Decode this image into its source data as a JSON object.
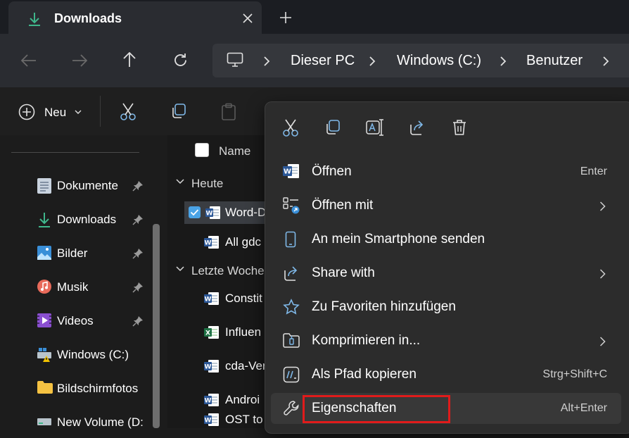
{
  "tab": {
    "title": "Downloads",
    "close_icon": "close-icon",
    "new_tab_icon": "plus-icon"
  },
  "nav": {
    "back_icon": "arrow-left-icon",
    "forward_icon": "arrow-right-icon",
    "up_icon": "arrow-up-icon",
    "refresh_icon": "refresh-icon",
    "breadcrumb": [
      "Dieser PC",
      "Windows (C:)",
      "Benutzer"
    ]
  },
  "command_bar": {
    "new_label": "Neu",
    "icons": [
      "cut-icon",
      "copy-icon",
      "paste-icon"
    ]
  },
  "sidebar": {
    "items": [
      {
        "label": "Dokumente",
        "icon": "documents-icon",
        "pinned": true
      },
      {
        "label": "Downloads",
        "icon": "download-icon",
        "pinned": true
      },
      {
        "label": "Bilder",
        "icon": "pictures-icon",
        "pinned": true
      },
      {
        "label": "Musik",
        "icon": "music-icon",
        "pinned": true
      },
      {
        "label": "Videos",
        "icon": "videos-icon",
        "pinned": true
      },
      {
        "label": "Windows (C:)",
        "icon": "drive-c-icon",
        "pinned": false
      },
      {
        "label": "Bildschirmfotos",
        "icon": "folder-icon",
        "pinned": false
      },
      {
        "label": "New Volume (D:",
        "icon": "drive-icon",
        "pinned": false
      }
    ]
  },
  "file_list": {
    "column_name": "Name",
    "groups": [
      {
        "label": "Heute",
        "files": [
          {
            "name": "Word-D",
            "type": "word",
            "selected": true
          },
          {
            "name": "All gdc",
            "type": "word",
            "selected": false
          }
        ]
      },
      {
        "label": "Letzte Woche",
        "files": [
          {
            "name": "Constit",
            "type": "word"
          },
          {
            "name": "Influen",
            "type": "excel"
          },
          {
            "name": "cda-Ver",
            "type": "word"
          },
          {
            "name": "Androi",
            "type": "word"
          },
          {
            "name": "OST to",
            "type": "word"
          }
        ]
      }
    ]
  },
  "context_menu": {
    "top_actions": [
      "cut-icon",
      "copy-icon",
      "rename-icon",
      "share-icon",
      "delete-icon"
    ],
    "items": [
      {
        "label": "Öffnen",
        "shortcut": "Enter",
        "icon": "word-icon",
        "submenu": false
      },
      {
        "label": "Öffnen mit",
        "shortcut": "",
        "icon": "open-with-icon",
        "submenu": true
      },
      {
        "label": "An mein Smartphone senden",
        "shortcut": "",
        "icon": "phone-icon",
        "submenu": false
      },
      {
        "label": "Share with",
        "shortcut": "",
        "icon": "share-icon",
        "submenu": true
      },
      {
        "label": "Zu Favoriten hinzufügen",
        "shortcut": "",
        "icon": "star-icon",
        "submenu": false
      },
      {
        "label": "Komprimieren in...",
        "shortcut": "",
        "icon": "zip-folder-icon",
        "submenu": true
      },
      {
        "label": "Als Pfad kopieren",
        "shortcut": "Strg+Shift+C",
        "icon": "copy-path-icon",
        "submenu": false
      },
      {
        "label": "Eigenschaften",
        "shortcut": "Alt+Enter",
        "icon": "wrench-icon",
        "submenu": false
      }
    ],
    "highlight_color": "#e01b1b"
  },
  "colors": {
    "accent": "#4aa3e6",
    "background": "#1c1c1c",
    "menu": "#2c2c2c"
  }
}
